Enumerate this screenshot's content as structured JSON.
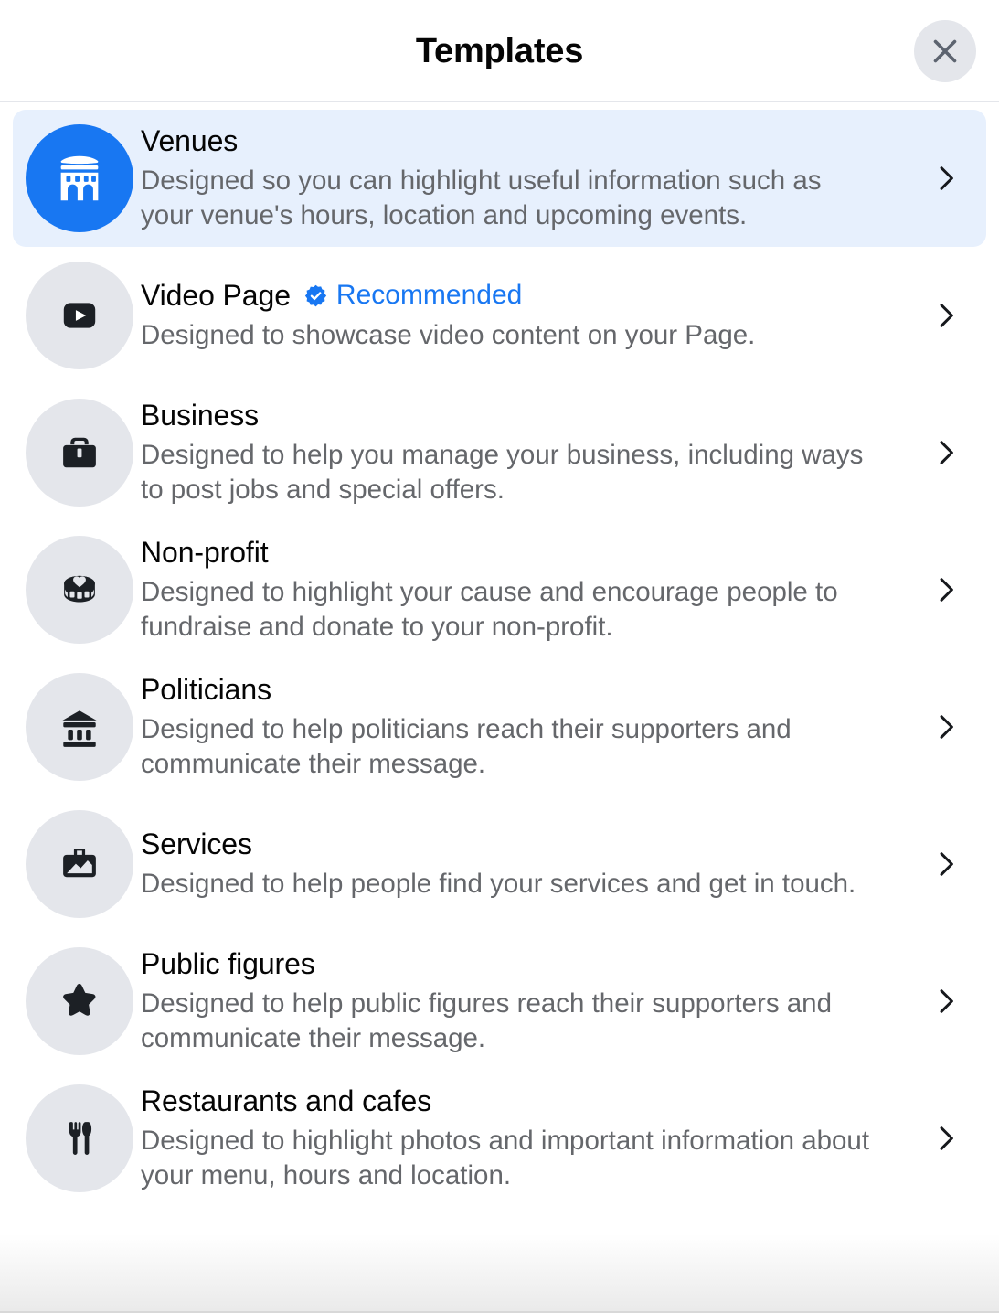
{
  "header": {
    "title": "Templates",
    "close_label": "Close",
    "close_icon": "close-icon"
  },
  "colors": {
    "accent": "#1877F2",
    "selected_row_bg": "#E7F0FD",
    "icon_bubble_bg": "#E4E6EB",
    "title_text": "#050505",
    "description_text": "#65676B"
  },
  "list": {
    "chevron_icon": "chevron-right-icon",
    "items": [
      {
        "id": "venues",
        "title": "Venues",
        "description": "Designed so you can highlight useful information such as your venue's hours, location and upcoming events.",
        "icon": "stadium-icon",
        "selected": true,
        "badge": null,
        "badge_label": null
      },
      {
        "id": "video-page",
        "title": "Video Page",
        "description": "Designed to showcase video content on your Page.",
        "icon": "video-play-icon",
        "selected": false,
        "badge": "verified-badge-icon",
        "badge_label": "Recommended"
      },
      {
        "id": "business",
        "title": "Business",
        "description": "Designed to help you manage your business, including ways to post jobs and special offers.",
        "icon": "briefcase-icon",
        "selected": false,
        "badge": null,
        "badge_label": null
      },
      {
        "id": "non-profit",
        "title": "Non-profit",
        "description": "Designed to highlight your cause and encourage people to fundraise and donate to your non-profit.",
        "icon": "donation-coin-heart-icon",
        "selected": false,
        "badge": null,
        "badge_label": null
      },
      {
        "id": "politicians",
        "title": "Politicians",
        "description": "Designed to help politicians reach their supporters and communicate their message.",
        "icon": "government-building-icon",
        "selected": false,
        "badge": null,
        "badge_label": null
      },
      {
        "id": "services",
        "title": "Services",
        "description": "Designed to help people find your services and get in touch.",
        "icon": "services-portfolio-icon",
        "selected": false,
        "badge": null,
        "badge_label": null
      },
      {
        "id": "public-figures",
        "title": "Public figures",
        "description": "Designed to help public figures reach their supporters and communicate their message.",
        "icon": "star-icon",
        "selected": false,
        "badge": null,
        "badge_label": null
      },
      {
        "id": "restaurants-and-cafes",
        "title": "Restaurants and cafes",
        "description": "Designed to highlight photos and important information about your menu, hours and location.",
        "icon": "fork-knife-icon",
        "selected": false,
        "badge": null,
        "badge_label": null
      }
    ]
  }
}
